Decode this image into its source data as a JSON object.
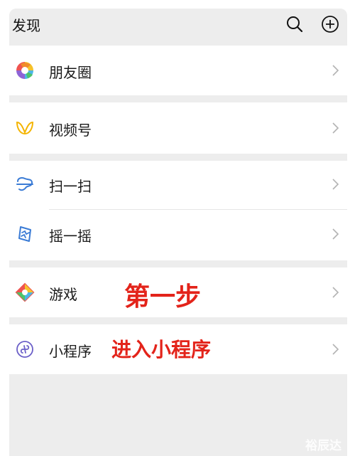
{
  "header": {
    "title": "发现",
    "search_icon": "search-icon",
    "add_icon": "plus-circle-icon"
  },
  "items": [
    {
      "label": "朋友圈",
      "icon": "moments-icon"
    },
    {
      "label": "视频号",
      "icon": "channels-icon"
    },
    {
      "label": "扫一扫",
      "icon": "scan-icon"
    },
    {
      "label": "摇一摇",
      "icon": "shake-icon"
    },
    {
      "label": "游戏",
      "icon": "game-icon"
    },
    {
      "label": "小程序",
      "icon": "mini-program-icon"
    }
  ],
  "annotations": {
    "step1": "第一步",
    "enter_mini_program": "进入小程序"
  },
  "watermark": "裕辰达",
  "colors": {
    "background": "#ededed",
    "card": "#ffffff",
    "annotation": "#e3231a",
    "channels_accent": "#f4b400",
    "scan_accent": "#3a7bd5",
    "mini_program_accent": "#6b5fc8"
  }
}
